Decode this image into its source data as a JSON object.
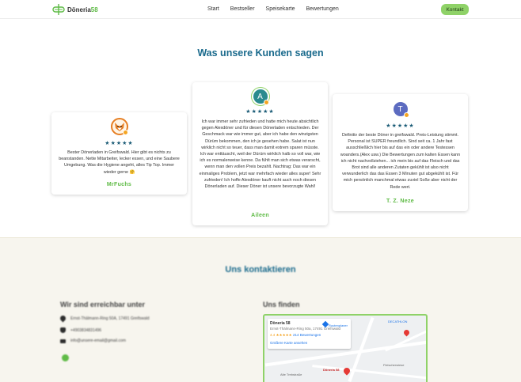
{
  "header": {
    "logo_text_main": "Döneria",
    "logo_text_accent": "58",
    "nav": [
      "Start",
      "Bestseller",
      "Speisekarte",
      "Bewertungen"
    ],
    "cta": "Kontakt",
    "accent_color": "#8fd268"
  },
  "reviews": {
    "title": "Was unsere Kunden sagen",
    "stars": "★★★★★",
    "items": [
      {
        "avatar": "",
        "text": "Bester Dönerladen in Greifswald. Hier gibt es nichts zu beanstanden. Nette Mitarbeiter, lecker essen, und eine Saubere Umgebung. Was die Hygiene angeht, alles Tip Top. Immer wieder gerne 🤗",
        "author": "MrFuchs"
      },
      {
        "avatar": "A",
        "text": "Ich war immer sehr zufrieden und hatte mich heute absichtlich gegen Alexdöner und für diesen Dönerladen entschieden. Der Geschmack war wie immer gut, aber ich habe den winzigsten Dürüm bekommen, den ich je gesehen habe. Salat ist nun wirklich nicht so teuer, dass man damit extrem sparen müsste. Ich war enttäuscht, weil der Dürüm wirklich halb so voll war, wie ich es normalerweise kenne. Da fühlt man sich etwas verarscht, wenn man den vollen Preis bezahlt. Nachtrag: Das war ein einmaliges Problem, jetzt war mehrfach wieder alles super! Sehr zufrieden! Ich hoffe Alexdöner kauft nicht auch noch diesen Dönerladen auf. Dieser Döner ist unsere bevorzugte Wahl!",
        "author": "Aileen"
      },
      {
        "avatar": "T",
        "text": "Definitiv der beste Döner in greifswald. Preis-Leistung stimmt. Personal ist SUPER freundlich. Sind seit ca. 1 Jahr fast ausschließlich hier bis auf das ein oder andere Testessen woanders.(Alex usw.) Die Bewertungen zum kalten Essen kann ich nicht nachvollziehen... ich mein bis auf das Fleisch und das Brot sind alle anderen Zutaten gekühlt ist also nicht verwunderlich das das Essen 3 Minuten gut abgekühlt ist. Für mich persönlich manchmal etwas zuviel Soße aber nicht der Rede wert.",
        "author": "T. Z. Neze"
      }
    ]
  },
  "contact": {
    "title": "Uns kontaktieren",
    "reach_title": "Wir sind erreichbar unter",
    "find_title": "Uns finden",
    "address": "Ernst-Thälmann-Ring 50A, 17491 Greifswald",
    "phone": "+4903834831496",
    "email": "info@unsere-email@gmail.com",
    "map": {
      "place_name": "Döneria 58",
      "place_line": "Ernst-Thälmann-Ring 50a, 17491 Greifswald",
      "rating": "4.4 ★★★★★",
      "reviews_link": "214 Bewertungen",
      "bigger_map": "Größere Karte ansehen",
      "route": "Routenplaner",
      "pin_label": "Döneria 58",
      "street_labels": [
        "DECATHLON",
        "Fleischerwiese",
        "Alte Trebstraße"
      ]
    }
  }
}
